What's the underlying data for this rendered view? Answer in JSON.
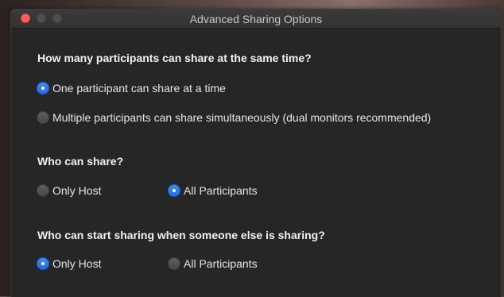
{
  "window": {
    "title": "Advanced Sharing Options"
  },
  "sections": [
    {
      "heading": "How many participants can share at the same time?",
      "options": [
        {
          "label": "One participant can share at a time",
          "selected": true
        },
        {
          "label": "Multiple participants can share simultaneously (dual monitors recommended)",
          "selected": false
        }
      ]
    },
    {
      "heading": "Who can share?",
      "options": [
        {
          "label": "Only Host",
          "selected": false
        },
        {
          "label": "All Participants",
          "selected": true
        }
      ]
    },
    {
      "heading": "Who can start sharing when someone else is sharing?",
      "options": [
        {
          "label": "Only Host",
          "selected": true
        },
        {
          "label": "All Participants",
          "selected": false
        }
      ]
    }
  ],
  "colors": {
    "accent": "#2a7ef0",
    "close_button": "#fe5f57",
    "window_background": "#262626"
  }
}
